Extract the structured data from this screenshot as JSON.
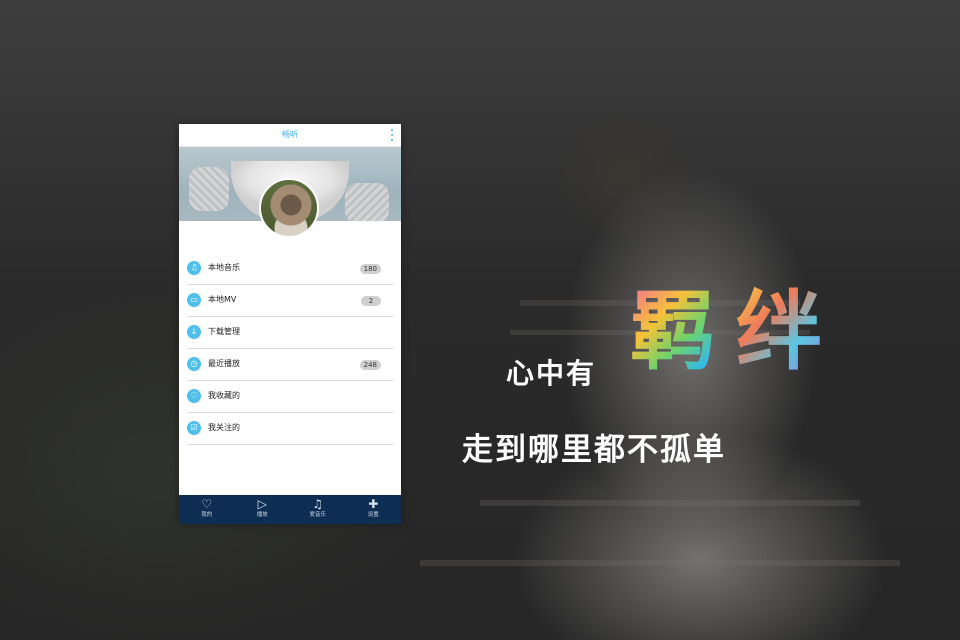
{
  "app": {
    "title": "畅听"
  },
  "menu": {
    "items": [
      {
        "label": "本地音乐",
        "count": "180",
        "icon": "music-note-icon",
        "glyph": "♫"
      },
      {
        "label": "本地MV",
        "count": "2",
        "icon": "video-icon",
        "glyph": "▭"
      },
      {
        "label": "下载管理",
        "count": "",
        "icon": "download-icon",
        "glyph": "↓"
      },
      {
        "label": "最近播放",
        "count": "248",
        "icon": "clock-icon",
        "glyph": "◷"
      },
      {
        "label": "我收藏的",
        "count": "",
        "icon": "heart-icon",
        "glyph": "♡"
      },
      {
        "label": "我关注的",
        "count": "",
        "icon": "checklist-icon",
        "glyph": "☑"
      }
    ]
  },
  "tabs": [
    {
      "label": "我的",
      "icon": "heart-outline-icon",
      "glyph": "♡"
    },
    {
      "label": "播放",
      "icon": "play-icon",
      "glyph": "▷"
    },
    {
      "label": "爱音乐",
      "icon": "music-note-icon",
      "glyph": "♫"
    },
    {
      "label": "设置",
      "icon": "puzzle-icon",
      "glyph": "✚"
    }
  ],
  "slogan": {
    "line1_prefix": "心中有",
    "line1_art_1": "羁",
    "line1_art_2": "绊",
    "line2": "走到哪里都不孤单"
  },
  "colors": {
    "accent": "#3fb3e6",
    "icon_circle": "#4fc0ea",
    "tab_bar": "#0d2d52",
    "badge": "#cfcfcf"
  }
}
